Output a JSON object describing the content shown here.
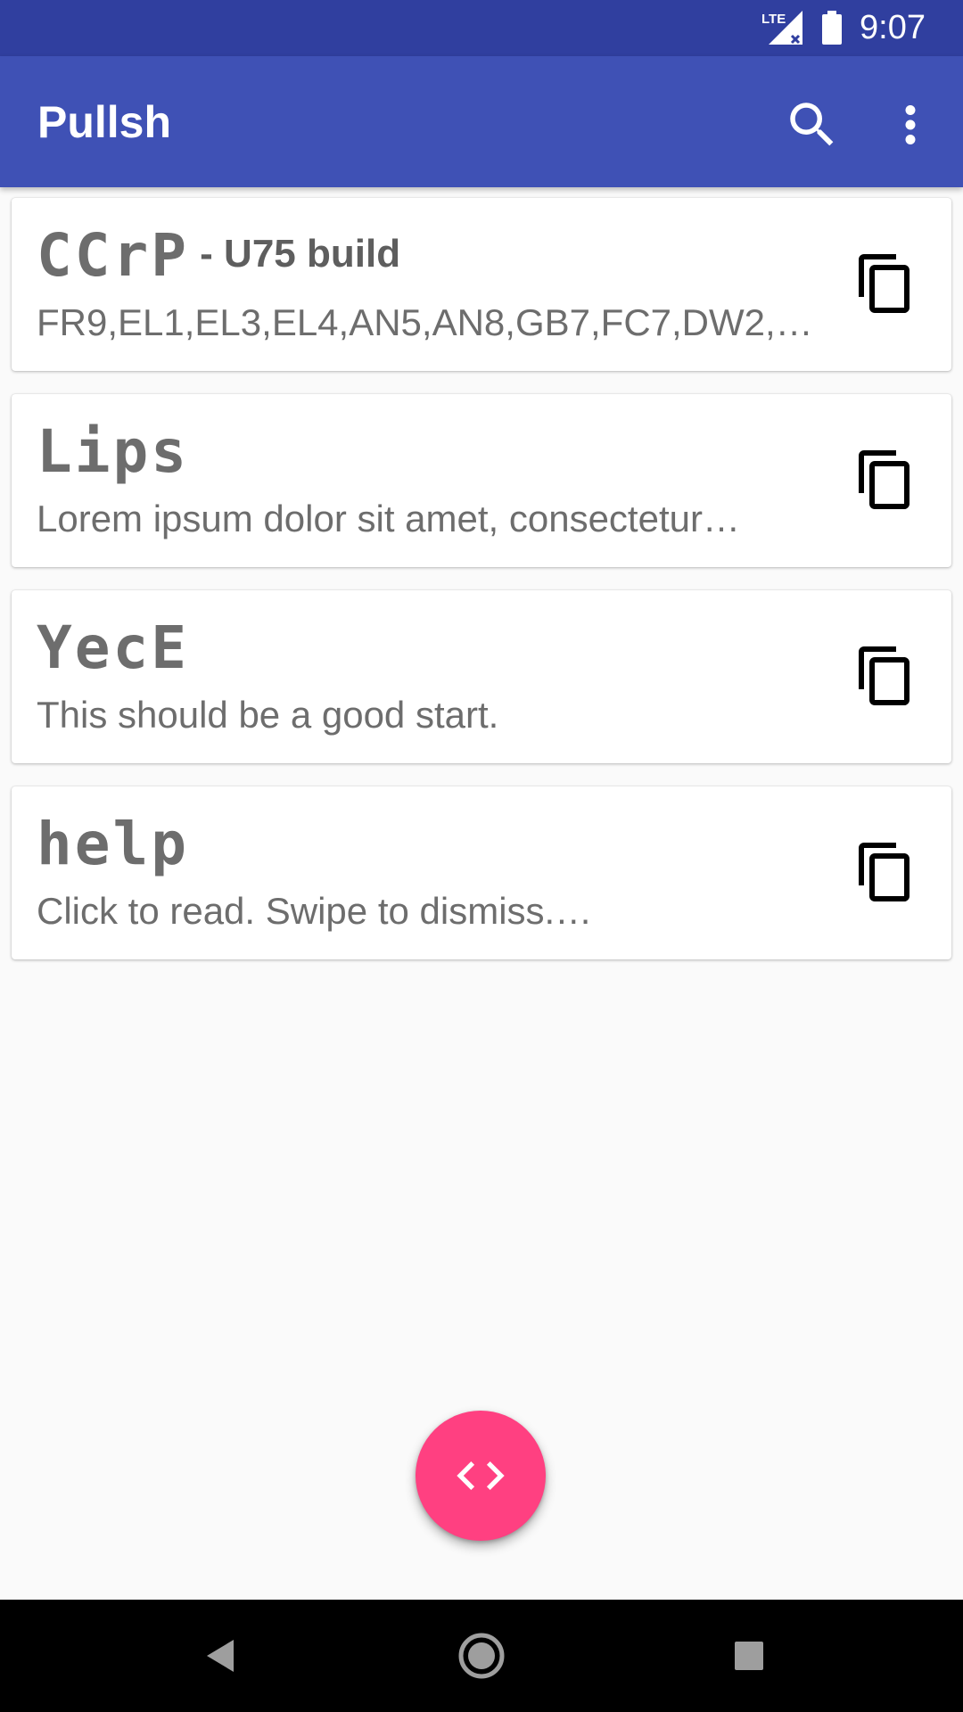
{
  "status_bar": {
    "time": "9:07",
    "network_label": "LTE",
    "icons": [
      "lte-signal-icon",
      "battery-icon"
    ]
  },
  "app_bar": {
    "title": "Pullsh",
    "actions": [
      "search-icon",
      "more-vert-icon"
    ],
    "color": "#3f51b5"
  },
  "cards": [
    {
      "name": "CCrP",
      "suffix": " - U75 build",
      "description": "FR9,EL1,EL3,EL4,AN5,AN8,GB7,FC7,DW2,…",
      "action_icon": "copy-icon"
    },
    {
      "name": "Lips",
      "suffix": "",
      "description": "Lorem ipsum dolor sit amet, consectetur…",
      "action_icon": "copy-icon"
    },
    {
      "name": "YecE",
      "suffix": "",
      "description": "This should be a good start.",
      "action_icon": "copy-icon"
    },
    {
      "name": "help",
      "suffix": "",
      "description": "Click to read. Swipe to dismiss.…",
      "action_icon": "copy-icon"
    }
  ],
  "fab": {
    "icon": "code-icon",
    "color": "#ff4081"
  },
  "nav_bar": {
    "buttons": [
      "back-icon",
      "home-icon",
      "recents-icon"
    ]
  }
}
